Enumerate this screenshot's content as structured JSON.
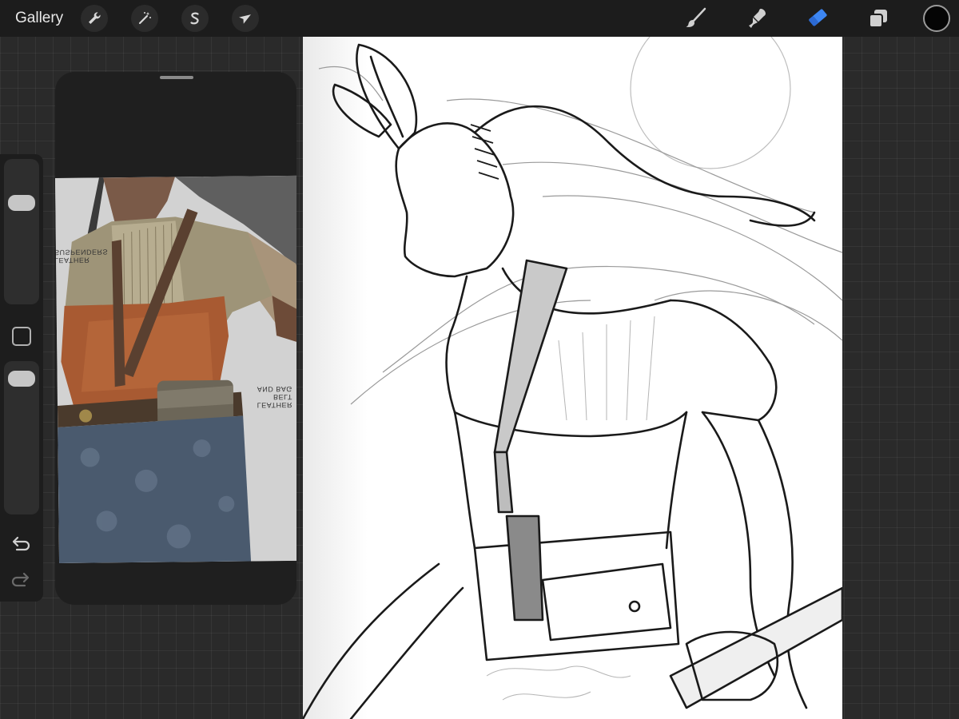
{
  "toolbar": {
    "gallery_label": "Gallery",
    "left_tools": [
      {
        "name": "actions",
        "icon": "wrench-icon"
      },
      {
        "name": "adjustments",
        "icon": "magic-wand-icon"
      },
      {
        "name": "selection",
        "icon": "selection-s-icon"
      },
      {
        "name": "transform",
        "icon": "arrow-cursor-icon"
      }
    ],
    "right_tools": [
      {
        "name": "brush",
        "icon": "brush-icon",
        "active": false
      },
      {
        "name": "smudge",
        "icon": "smudge-icon",
        "active": false
      },
      {
        "name": "eraser",
        "icon": "eraser-icon",
        "active": true
      },
      {
        "name": "layers",
        "icon": "layers-icon",
        "active": false
      }
    ],
    "current_color": "#050505",
    "active_tool_color": "#3d86f2"
  },
  "sidebar": {
    "brush_size_icon": "size-slider",
    "opacity_icon": "opacity-slider",
    "modify_icon": "square-icon",
    "undo_icon": "undo-arrow-icon",
    "redo_icon": "redo-arrow-icon"
  },
  "reference": {
    "label_top": "LEATHER\nSUSPENDERS",
    "label_bottom": "LEATHER BELT\nAND BAG"
  }
}
